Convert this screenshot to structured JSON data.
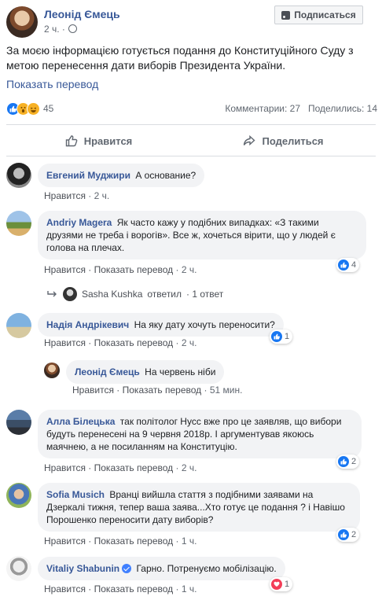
{
  "post": {
    "author": "Леонід Ємець",
    "time": "2 ч. ·",
    "subscribe_label": "Подписаться",
    "text": "За моєю інформацією готується подання до Конституційного Суду з метою перенесення дати виборів Президента України.",
    "translate_label": "Показать перевод",
    "reaction_count": "45",
    "comments_count": "Комментарии: 27",
    "shares_count": "Поделились: 14",
    "like_label": "Нравится",
    "share_label": "Поделиться"
  },
  "comments": [
    {
      "name": "Евгений Муджири",
      "text": "А основание?",
      "meta_like": "Нравится",
      "meta_time": "· 2 ч."
    },
    {
      "name": "Andriy Magera",
      "text": "Як часто кажу у подібних випадках: «З такими друзями не треба і ворогів». Все ж, хочеться вірити, що у людей є голова на плечах.",
      "meta_like": "Нравится",
      "meta_translate": "· Показать перевод",
      "meta_time": "· 2 ч.",
      "reactions": "4"
    },
    {
      "name": "Надія Андрікевич",
      "text": "На яку дату хочуть переносити?",
      "meta_like": "Нравится",
      "meta_translate": "· Показать перевод",
      "meta_time": "· 2 ч.",
      "reactions": "1"
    },
    {
      "name": "Леонід Ємець",
      "text": "На червень ніби",
      "meta_like": "Нравится",
      "meta_translate": "· Показать перевод",
      "meta_time": "· 51 мин."
    },
    {
      "name": "Алла Білецька",
      "text": "так політолог Нусс вже про це заявляв, що вибори будуть перенесені на 9 червня 2018р. І аргументував якоюсь маячнею, а не посиланням на Конституцію.",
      "meta_like": "Нравится",
      "meta_translate": "· Показать перевод",
      "meta_time": "· 2 ч.",
      "reactions": "2"
    },
    {
      "name": "Sofia Musich",
      "text": "Вранці вийшла стаття з подібними заявами на Дзеркалі тижня, тепер ваша заява...Хто готує це подання ? і Навішо Порошенко переносити дату виборів?",
      "meta_like": "Нравится",
      "meta_translate": "· Показать перевод",
      "meta_time": "· 1 ч.",
      "reactions": "2"
    },
    {
      "name": "Vitaliy Shabunin",
      "text": "Гарно. Потренуємо мобілізацію.",
      "meta_like": "Нравится",
      "meta_translate": "· Показать перевод",
      "meta_time": "· 1 ч.",
      "reactions": "1"
    }
  ],
  "reply_summary": {
    "name": "Sasha Kushka",
    "action": "ответил",
    "count": "· 1 ответ"
  },
  "colors": {
    "link": "#385898",
    "like_blue": "#1877f2",
    "bubble": "#f2f3f5",
    "love_red": "#f33e58"
  }
}
